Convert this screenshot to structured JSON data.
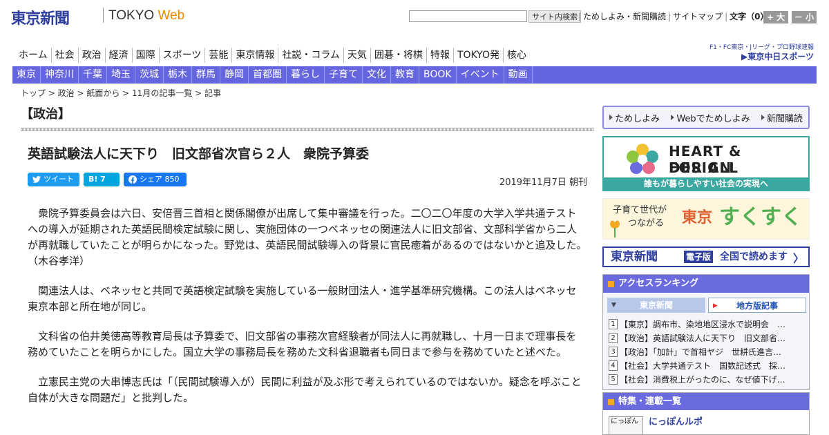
{
  "header": {
    "logo": "東京新聞",
    "logo_sub": "TOKYO",
    "logo_web": "Web",
    "search_placeholder": "",
    "search_button": "サイト内検索",
    "links": [
      "ためしよみ・新聞購読",
      "サイトマップ"
    ],
    "font_size_label": "文字（0）",
    "font_bigger": "+ 大",
    "font_smaller": "－ 小"
  },
  "nav_main": [
    "ホーム",
    "社会",
    "政治",
    "経済",
    "国際",
    "スポーツ",
    "芸能",
    "東京情報",
    "社説・コラム",
    "天気",
    "囲碁・将棋",
    "特報",
    "TOKYO発",
    "核心"
  ],
  "sports_banner": {
    "line1": "F1・FC東京・Jリーグ・プロ野球速報",
    "line2": "▶東京中日スポーツ"
  },
  "nav_region": [
    "東京",
    "神奈川",
    "千葉",
    "埼玉",
    "茨城",
    "栃木",
    "群馬",
    "静岡",
    "首都圏",
    "暮らし",
    "子育て",
    "文化",
    "教育",
    "BOOK",
    "イベント",
    "動画"
  ],
  "breadcrumb": "トップ > 政治 > 紙面から > 11月の記事一覧 > 記事",
  "category": "【政治】",
  "article": {
    "title": "英語試験法人に天下り　旧文部省次官ら２人　衆院予算委",
    "share": {
      "tweet": "ツイート",
      "hatena": "B! 7",
      "facebook": "シェア 850"
    },
    "date": "2019年11月7日 朝刊",
    "paragraphs": [
      "衆院予算委員会は六日、安倍晋三首相と関係閣僚が出席して集中審議を行った。二〇二〇年度の大学入学共通テストへの導入が延期された英語民間検定試験に関し、実施団体の一つベネッセの関連法人に旧文部省、文部科学省から二人が再就職していたことが明らかになった。野党は、英語民間試験導入の背景に官民癒着があるのではないかと追及した。　（木谷孝洋）",
      "関連法人は、ベネッセと共同で英語検定試験を実施している一般財団法人・進学基準研究機構。この法人はベネッセ東京本部と所在地が同じ。",
      "文科省の伯井美徳高等教育局長は予算委で、旧文部省の事務次官経験者が同法人に再就職し、十月一日まで理事長を務めていたことを明らかにした。国立大学の事務局長を務めた文科省退職者も同日まで参与を務めていたと述べた。",
      "立憲民主党の大串博志氏は「（民間試験導入が）民間に利益が及ぶ形で考えられているのではないか。疑念を呼ぶこと自体が大きな問題だ」と批判した。"
    ]
  },
  "sidebar": {
    "tameshi": [
      "ためしよみ",
      "Webでためしよみ",
      "新聞購読"
    ],
    "heart_design": {
      "line1": "HEART & DESIGN",
      "line2": "FOR ALL",
      "caption": "誰もが暮らしやすい社会の実現へ"
    },
    "sukusuku": {
      "line1": "子育て世代が",
      "line2": "つながる",
      "tokyo": "東京",
      "brand": "すくすく"
    },
    "denshi": {
      "logo": "東京新聞",
      "badge": "電子版",
      "text": "全国で読めます"
    },
    "ranking": {
      "title": "アクセスランキング",
      "tabs": [
        "東京新聞",
        "地方版記事"
      ],
      "items": [
        {
          "n": "1",
          "text": "【東京】調布市、染地地区浸水で説明会　…"
        },
        {
          "n": "2",
          "text": "【政治】英語試験法人に天下り　旧文部省…"
        },
        {
          "n": "3",
          "text": "【政治】「加計」で首相ヤジ　世耕氏進言…"
        },
        {
          "n": "4",
          "text": "【社会】大学共通テスト　国数記述式　採…"
        },
        {
          "n": "5",
          "text": "【社会】消費税上がったのに、なぜ値下げ…"
        }
      ]
    },
    "special": {
      "title": "特集・連載一覧",
      "thumb": "にっぽん",
      "item": "にっぽんルポ"
    }
  },
  "colors": {
    "brand": "#2f3f9e",
    "nav_bar": "#6565e0",
    "teal": "#3aa8a0",
    "accent": "#f5a623"
  }
}
